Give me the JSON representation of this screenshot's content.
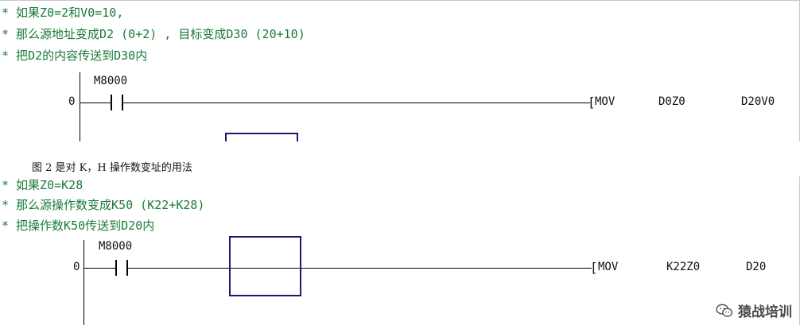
{
  "rung1": {
    "comments": [
      "* 如果Z0=2和V0=10,",
      "* 那么源地址变成D2 (0+2) , 目标变成D30 (20+10)",
      "* 把D2的内容传送到D30内"
    ],
    "step": "0",
    "contact": "M8000",
    "instruction": "MOV",
    "operand1": "D0Z0",
    "operand2": "D20V0"
  },
  "caption": "图 2 是对 K，H 操作数变址的用法",
  "rung2": {
    "comments": [
      "* 如果Z0=K28",
      "* 那么源操作数变成K50 (K22+K28)",
      "* 把操作数K50传送到D20内"
    ],
    "step": "0",
    "contact": "M8000",
    "instruction": "MOV",
    "operand1": "K22Z0",
    "operand2": "D20"
  },
  "watermark": {
    "text": "猿战培训",
    "icon": "wechat-icon"
  }
}
